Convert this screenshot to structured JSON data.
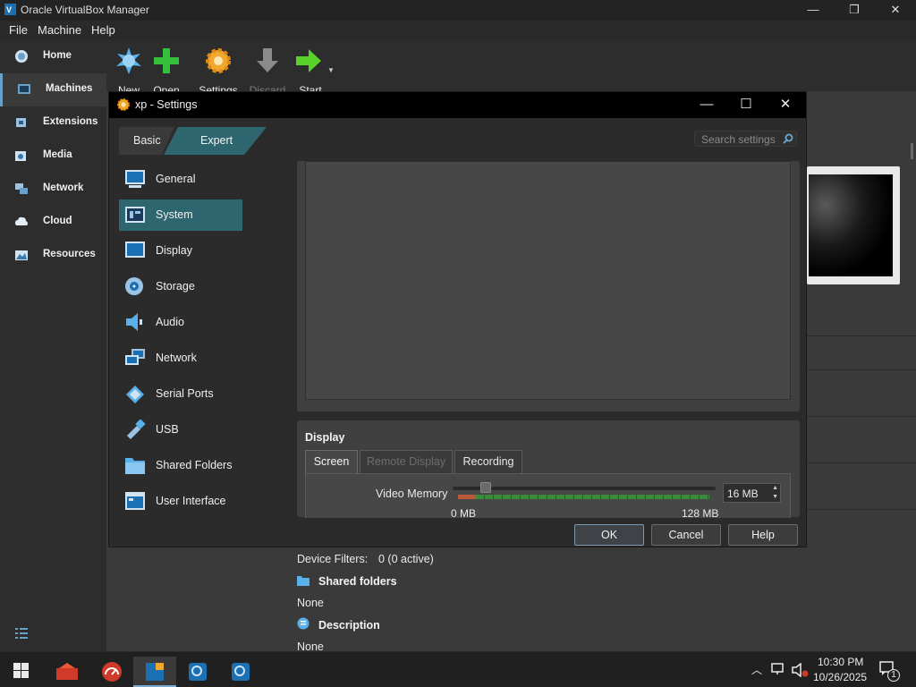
{
  "window": {
    "title": "Oracle VirtualBox Manager",
    "min": "—",
    "max": "❐",
    "close": "✕"
  },
  "menu": {
    "file": "File",
    "machine": "Machine",
    "help": "Help"
  },
  "leftnav": {
    "items": [
      {
        "label": "Home",
        "icon": "home-icon"
      },
      {
        "label": "Machines",
        "icon": "machines-icon"
      },
      {
        "label": "Extensions",
        "icon": "extensions-icon"
      },
      {
        "label": "Media",
        "icon": "media-icon"
      },
      {
        "label": "Network",
        "icon": "network-icon"
      },
      {
        "label": "Cloud",
        "icon": "cloud-icon"
      },
      {
        "label": "Resources",
        "icon": "resources-icon"
      }
    ]
  },
  "toolbar": {
    "new": "New",
    "open": "Open",
    "settings": "Settings",
    "discard": "Discard",
    "start": "Start"
  },
  "dialog": {
    "title": "xp - Settings",
    "modes": {
      "basic": "Basic",
      "expert": "Expert"
    },
    "search_placeholder": "Search settings",
    "categories": [
      "General",
      "System",
      "Display",
      "Storage",
      "Audio",
      "Network",
      "Serial Ports",
      "USB",
      "Shared Folders",
      "User Interface"
    ],
    "display": {
      "heading": "Display",
      "tabs": {
        "screen": "Screen",
        "remote": "Remote Display",
        "recording": "Recording"
      },
      "video_memory_label": "Video Memory",
      "video_memory_value": "16 MB",
      "video_memory_fraction": 0.125,
      "min_label": "0 MB",
      "max_label": "128 MB"
    },
    "buttons": {
      "ok": "OK",
      "cancel": "Cancel",
      "help": "Help"
    }
  },
  "details": {
    "device_filters_label": "Device Filters:",
    "device_filters_value": "0 (0 active)",
    "shared_folders_header": "Shared folders",
    "shared_folders_value": "None",
    "description_header": "Description",
    "description_value": "None"
  },
  "taskbar": {
    "time": "10:30 PM",
    "date": "10/26/2025",
    "notifications": "1"
  }
}
